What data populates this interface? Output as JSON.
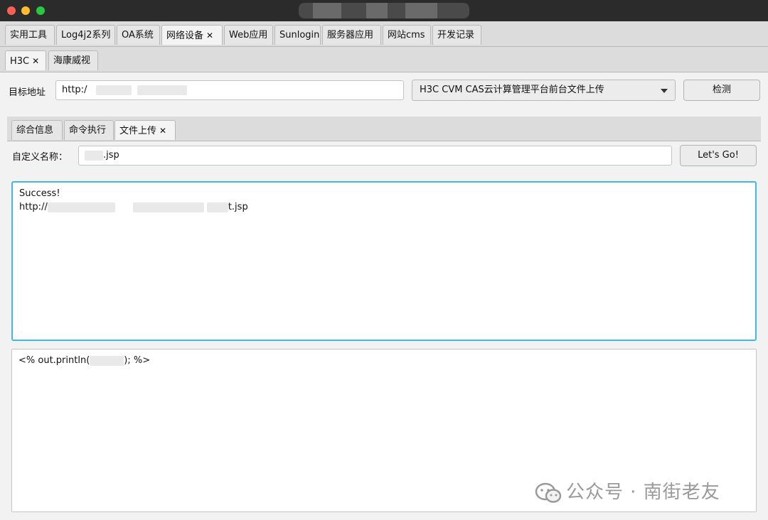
{
  "top_tabs": [
    {
      "label": "实用工具",
      "closable": false,
      "selected": false
    },
    {
      "label": "Log4j2系列",
      "closable": false,
      "selected": false
    },
    {
      "label": "OA系统",
      "closable": false,
      "selected": false
    },
    {
      "label": "网络设备",
      "closable": true,
      "selected": true
    },
    {
      "label": "Web应用",
      "closable": false,
      "selected": false
    },
    {
      "label": "Sunlogin",
      "closable": false,
      "selected": false
    },
    {
      "label": "服务器应用",
      "closable": false,
      "selected": false
    },
    {
      "label": "网站cms",
      "closable": false,
      "selected": false
    },
    {
      "label": "开发记录",
      "closable": false,
      "selected": false
    }
  ],
  "vendor_tabs": [
    {
      "label": "H3C",
      "closable": true,
      "selected": true
    },
    {
      "label": "海康威视",
      "closable": false,
      "selected": false
    }
  ],
  "close_glyph": "✕",
  "target": {
    "label": "目标地址",
    "value": "http:/"
  },
  "exploit_select": {
    "value": "H3C CVM CAS云计算管理平台前台文件上传"
  },
  "detect_button": "检测",
  "func_tabs": [
    {
      "label": "综合信息",
      "closable": false,
      "selected": false
    },
    {
      "label": "命令执行",
      "closable": false,
      "selected": false
    },
    {
      "label": "文件上传",
      "closable": true,
      "selected": true
    }
  ],
  "filename": {
    "label": "自定义名称：",
    "value": ".jsp"
  },
  "go_button": "Let's Go!",
  "result": {
    "line1": "Success!",
    "line2_prefix": "http://",
    "line2_suffix": "t.jsp"
  },
  "payload": {
    "prefix": "<% out.println(",
    "suffix": "); %>"
  },
  "watermark": {
    "text": "公众号 · 南街老友",
    "icon": "wechat-icon"
  },
  "colors": {
    "focus": "#3fb8e6",
    "titlebar": "#2b2b2b"
  }
}
